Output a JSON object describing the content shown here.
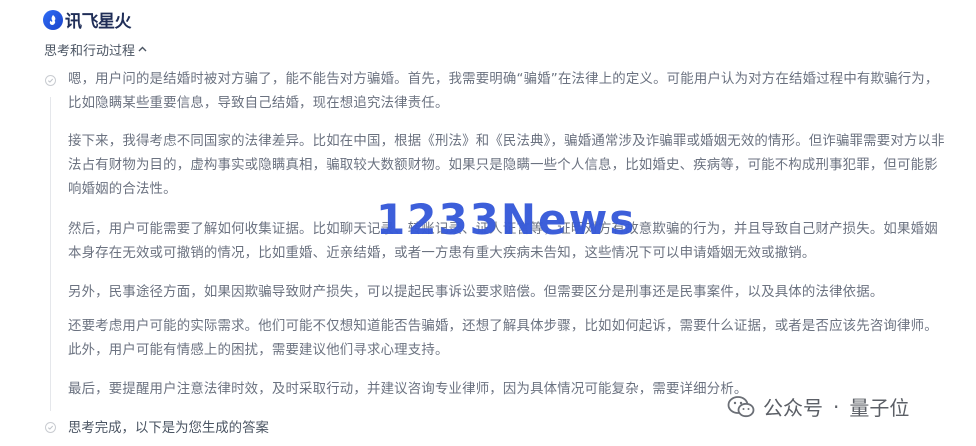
{
  "brand": {
    "name": "讯飞星火"
  },
  "thinking": {
    "header": "思考和行动过程",
    "paragraphs": [
      "嗯，用户问的是结婚时被对方骗了，能不能告对方骗婚。首先，我需要明确“骗婚”在法律上的定义。可能用户认为对方在结婚过程中有欺骗行为，比如隐瞒某些重要信息，导致自己结婚，现在想追究法律责任。",
      "接下来，我得考虑不同国家的法律差异。比如在中国，根据《刑法》和《民法典》，骗婚通常涉及诈骗罪或婚姻无效的情形。但诈骗罪需要对方以非法占有财物为目的，虚构事实或隐瞒真相，骗取较大数额财物。如果只是隐瞒一些个人信息，比如婚史、疾病等，可能不构成刑事犯罪，但可能影响婚姻的合法性。",
      "然后，用户可能需要了解如何收集证据。比如聊天记录、转账记录、证人证言等，证明对方有故意欺骗的行为，并且导致自己财产损失。如果婚姻本身存在无效或可撤销的情况，比如重婚、近亲结婚，或者一方患有重大疾病未告知，这些情况下可以申请婚姻无效或撤销。",
      "另外，民事途径方面，如果因欺骗导致财产损失，可以提起民事诉讼要求赔偿。但需要区分是刑事还是民事案件，以及具体的法律依据。",
      "还要考虑用户可能的实际需求。他们可能不仅想知道能否告骗婚，还想了解具体步骤，比如如何起诉，需要什么证据，或者是否应该先咨询律师。此外，用户可能有情感上的困扰，需要建议他们寻求心理支持。",
      "最后，要提醒用户注意法律时效，及时采取行动，并建议咨询专业律师，因为具体情况可能复杂，需要详细分析。"
    ],
    "final_status": "思考完成，以下是为您生成的答案"
  },
  "watermark": {
    "text": "1233News"
  },
  "wechat": {
    "label": "公众号",
    "separator": "·",
    "account": "量子位"
  }
}
